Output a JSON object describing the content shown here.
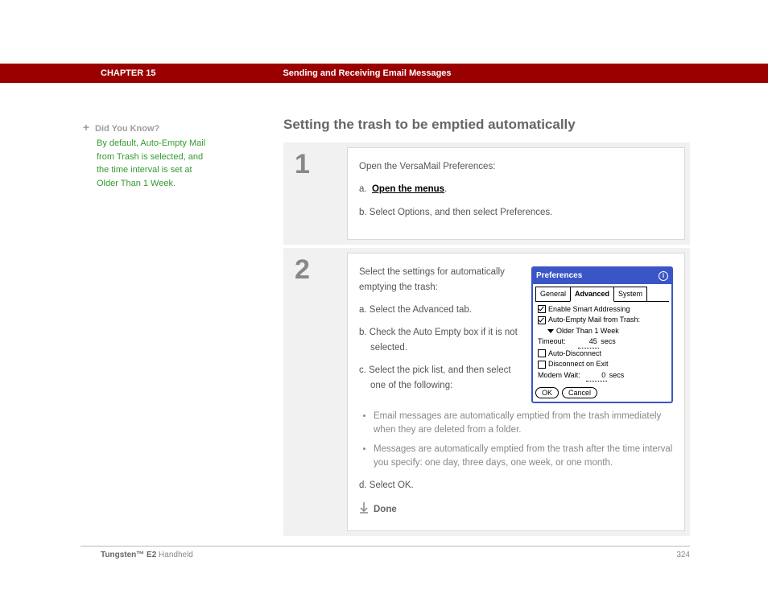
{
  "header": {
    "chapter": "CHAPTER 15",
    "title": "Sending and Receiving Email Messages"
  },
  "sidebar": {
    "tip": {
      "icon": "+",
      "heading": "Did You Know?",
      "body": "By default, Auto-Empty Mail from Trash is selected, and the time interval is set at Older Than 1 Week."
    }
  },
  "main": {
    "heading": "Setting the trash to be emptied automatically",
    "step1": {
      "num": "1",
      "intro": "Open the VersaMail Preferences:",
      "a_prefix": "a.",
      "a_link": "Open the menus",
      "a_suffix": ".",
      "b": "b.  Select Options, and then select Preferences."
    },
    "step2": {
      "num": "2",
      "intro": "Select the settings for automatically emptying the trash:",
      "a": "a.  Select the Advanced tab.",
      "b": "b.  Check the Auto Empty box if it is not selected.",
      "c": "c.  Select the pick list, and then select one of the following:",
      "bullet1": "Email messages are automatically emptied from the trash immediately when they are deleted from a folder.",
      "bullet2": "Messages are automatically emptied from the trash after the time interval you specify: one day, three days, one week, or one month.",
      "d": "d.  Select OK.",
      "done": "Done"
    }
  },
  "prefs": {
    "title": "Preferences",
    "tabs": {
      "general": "General",
      "advanced": "Advanced",
      "system": "System"
    },
    "smart": "Enable Smart Addressing",
    "autoempty": "Auto-Empty Mail from Trash:",
    "older": "Older Than 1 Week",
    "timeout_label": "Timeout:",
    "timeout_value": "45",
    "timeout_unit": "secs",
    "autodisc": "Auto-Disconnect",
    "disconnect_exit": "Disconnect on Exit",
    "modem_label": "Modem Wait:",
    "modem_value": "0",
    "modem_unit": "secs",
    "ok": "OK",
    "cancel": "Cancel"
  },
  "footer": {
    "product_bold": "Tungsten™ E2",
    "product_rest": " Handheld",
    "page": "324"
  }
}
